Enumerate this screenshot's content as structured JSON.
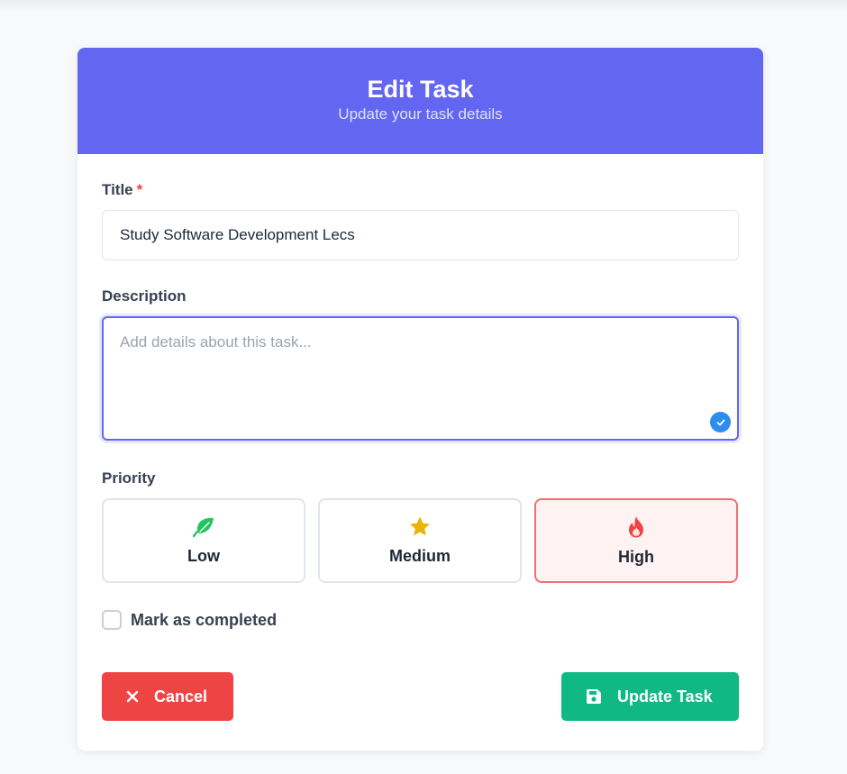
{
  "header": {
    "title": "Edit Task",
    "subtitle": "Update your task details"
  },
  "form": {
    "title_label": "Title",
    "required_marker": "*",
    "title_value": "Study Software Development Lecs",
    "description_label": "Description",
    "description_placeholder": "Add details about this task...",
    "priority_label": "Priority",
    "priorities": [
      {
        "label": "Low",
        "icon": "leaf-icon",
        "color": "#22c55e",
        "selected": false
      },
      {
        "label": "Medium",
        "icon": "star-icon",
        "color": "#eab308",
        "selected": false
      },
      {
        "label": "High",
        "icon": "fire-icon",
        "color": "#ef4444",
        "selected": true
      }
    ],
    "completed_label": "Mark as completed",
    "completed": false
  },
  "actions": {
    "cancel_label": "Cancel",
    "update_label": "Update Task"
  },
  "colors": {
    "header_bg": "#6366f1",
    "cancel_bg": "#ef4444",
    "update_bg": "#10b981"
  }
}
